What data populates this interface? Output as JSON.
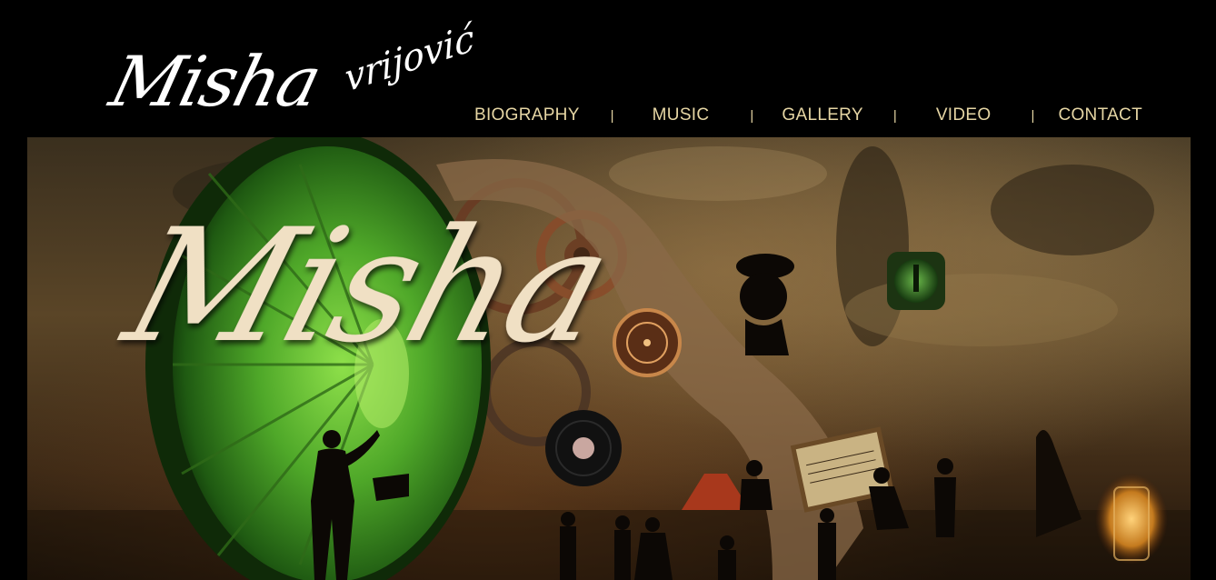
{
  "header": {
    "logo": {
      "first_name": "Misha",
      "last_name": "vrijović"
    },
    "nav": [
      {
        "label": "BIOGRAPHY"
      },
      {
        "label": "MUSIC"
      },
      {
        "label": "GALLERY"
      },
      {
        "label": "VIDEO"
      },
      {
        "label": "CONTACT"
      }
    ],
    "separator": "|"
  },
  "banner": {
    "title": "Misha"
  },
  "colors": {
    "background": "#000000",
    "nav_text": "#e6d6a4",
    "hero_text": "#f0e0c4",
    "gramophone_green": "#4fa829"
  }
}
